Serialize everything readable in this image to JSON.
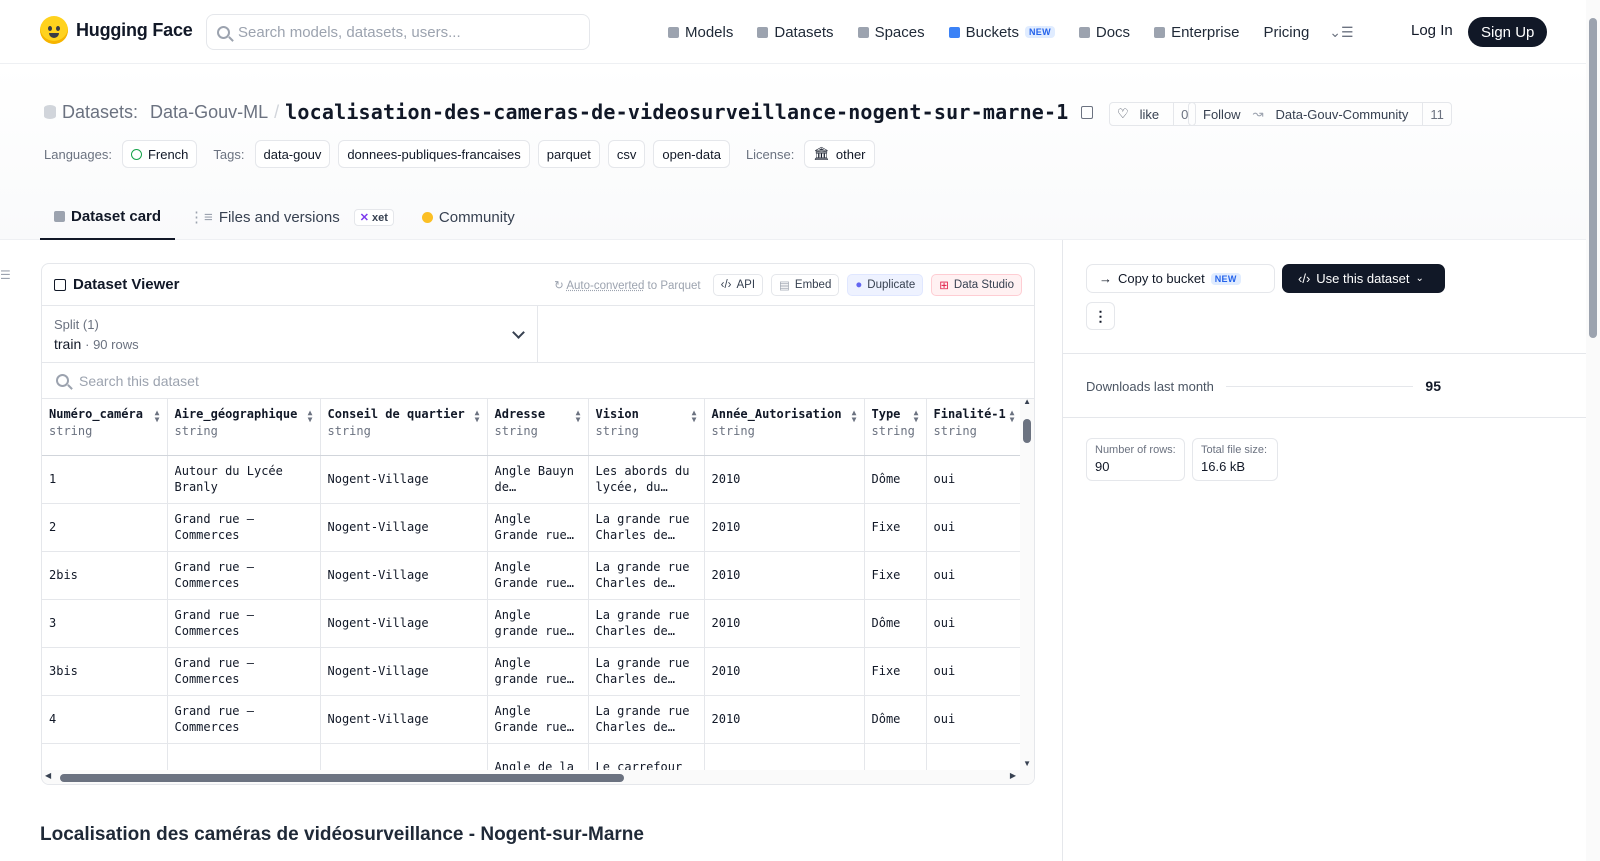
{
  "nav": {
    "brand": "Hugging Face",
    "search_placeholder": "Search models, datasets, users...",
    "items": [
      {
        "label": "Models",
        "icon": "cube-icon"
      },
      {
        "label": "Datasets",
        "icon": "database-icon"
      },
      {
        "label": "Spaces",
        "icon": "grid-icon"
      },
      {
        "label": "Buckets",
        "icon": "bucket-icon",
        "badge": "NEW"
      },
      {
        "label": "Docs",
        "icon": "book-icon"
      },
      {
        "label": "Enterprise",
        "icon": "enterprise-icon"
      },
      {
        "label": "Pricing"
      }
    ],
    "login": "Log In",
    "signup": "Sign Up"
  },
  "header": {
    "section": "Datasets:",
    "org": "Data-Gouv-ML",
    "separator": "/",
    "name": "localisation-des-cameras-de-videosurveillance-nogent-sur-marne-1",
    "like_label": "like",
    "like_count": "0",
    "follow_label": "Follow",
    "follow_org": "Data-Gouv-Community",
    "follow_count": "11",
    "languages_label": "Languages:",
    "language": "French",
    "tags_label": "Tags:",
    "tags": [
      "data-gouv",
      "donnees-publiques-francaises",
      "parquet",
      "csv",
      "open-data"
    ],
    "license_label": "License:",
    "license": "other"
  },
  "tabs": {
    "card": "Dataset card",
    "files": "Files and versions",
    "xet": "xet",
    "community": "Community"
  },
  "viewer": {
    "title": "Dataset Viewer",
    "auto": "Auto-converted",
    "auto_suffix": "to Parquet",
    "api": "API",
    "embed": "Embed",
    "duplicate": "Duplicate",
    "studio": "Data Studio",
    "split_label": "Split (1)",
    "split_value": "train",
    "split_rows": "90 rows",
    "search_placeholder": "Search this dataset",
    "columns": [
      {
        "name": "Numéro_caméra",
        "type": "string"
      },
      {
        "name": "Aire_géographique",
        "type": "string"
      },
      {
        "name": "Conseil de quartier",
        "type": "string"
      },
      {
        "name": "Adresse",
        "type": "string"
      },
      {
        "name": "Vision",
        "type": "string"
      },
      {
        "name": "Année_Autorisation",
        "type": "string"
      },
      {
        "name": "Type",
        "type": "string"
      },
      {
        "name": "Finalité-1",
        "type": "string"
      }
    ],
    "rows": [
      [
        "1",
        "Autour du Lycée Branly",
        "Nogent-Village",
        "Angle Bauyn de Perreuse…",
        "Les abords du lycée, du…",
        "2010",
        "Dôme",
        "oui"
      ],
      [
        "2",
        "Grand rue – Commerces",
        "Nogent-Village",
        "Angle Grande rue Charle…",
        "La grande rue Charles de…",
        "2010",
        "Fixe",
        "oui"
      ],
      [
        "2bis",
        "Grand rue – Commerces",
        "Nogent-Village",
        "Angle Grande rue Charle…",
        "La grande rue Charles de…",
        "2010",
        "Fixe",
        "oui"
      ],
      [
        "3",
        "Grand rue – Commerces",
        "Nogent-Village",
        "Angle grande rue Charle…",
        "La grande rue Charles de…",
        "2010",
        "Dôme",
        "oui"
      ],
      [
        "3bis",
        "Grand rue – Commerces",
        "Nogent-Village",
        "Angle grande rue Charle…",
        "La grande rue Charles de…",
        "2010",
        "Fixe",
        "oui"
      ],
      [
        "4",
        "Grand rue – Commerces",
        "Nogent-Village",
        "Angle Grande rue Charle…",
        "La grande rue Charles de…",
        "2010",
        "Dôme",
        "oui"
      ],
      [
        "",
        "",
        "",
        "Angle de la",
        "Le carrefour",
        "",
        "",
        ""
      ]
    ]
  },
  "sidebar": {
    "copy_bucket": "Copy to bucket",
    "copy_badge": "NEW",
    "use_dataset": "Use this dataset",
    "downloads_label": "Downloads last month",
    "downloads_value": "95",
    "rows_label": "Number of rows:",
    "rows_value": "90",
    "size_label": "Total file size:",
    "size_value": "16.6 kB"
  },
  "readme": {
    "title": "Localisation des caméras de vidéosurveillance - Nogent-sur-Marne"
  }
}
